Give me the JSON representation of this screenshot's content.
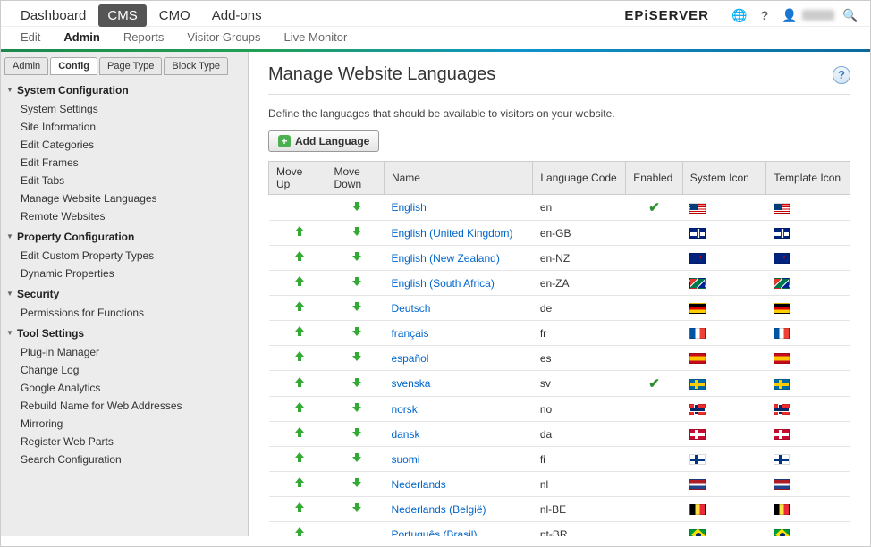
{
  "topnav": {
    "items": [
      "Dashboard",
      "CMS",
      "CMO",
      "Add-ons"
    ],
    "active_index": 1,
    "brand": "EPiSERVER"
  },
  "subnav": {
    "items": [
      "Edit",
      "Admin",
      "Reports",
      "Visitor Groups",
      "Live Monitor"
    ],
    "active_index": 1
  },
  "sideTabs": {
    "items": [
      "Admin",
      "Config",
      "Page Type",
      "Block Type"
    ],
    "active_index": 1
  },
  "tree": [
    {
      "label": "System Configuration",
      "items": [
        "System Settings",
        "Site Information",
        "Edit Categories",
        "Edit Frames",
        "Edit Tabs",
        "Manage Website Languages",
        "Remote Websites"
      ]
    },
    {
      "label": "Property Configuration",
      "items": [
        "Edit Custom Property Types",
        "Dynamic Properties"
      ]
    },
    {
      "label": "Security",
      "items": [
        "Permissions for Functions"
      ]
    },
    {
      "label": "Tool Settings",
      "items": [
        "Plug-in Manager",
        "Change Log",
        "Google Analytics",
        "Rebuild Name for Web Addresses",
        "Mirroring",
        "Register Web Parts",
        "Search Configuration"
      ]
    }
  ],
  "page": {
    "title": "Manage Website Languages",
    "description": "Define the languages that should be available to visitors on your website.",
    "add_button": "Add Language"
  },
  "table": {
    "headers": {
      "move_up": "Move Up",
      "move_down": "Move Down",
      "name": "Name",
      "code": "Language Code",
      "enabled": "Enabled",
      "sys_icon": "System Icon",
      "tpl_icon": "Template Icon"
    },
    "rows": [
      {
        "name": "English",
        "code": "en",
        "enabled": true,
        "flag": "us",
        "canUp": false,
        "canDown": true
      },
      {
        "name": "English (United Kingdom)",
        "code": "en-GB",
        "enabled": false,
        "flag": "gb",
        "canUp": true,
        "canDown": true
      },
      {
        "name": "English (New Zealand)",
        "code": "en-NZ",
        "enabled": false,
        "flag": "nz",
        "canUp": true,
        "canDown": true
      },
      {
        "name": "English (South Africa)",
        "code": "en-ZA",
        "enabled": false,
        "flag": "za",
        "canUp": true,
        "canDown": true
      },
      {
        "name": "Deutsch",
        "code": "de",
        "enabled": false,
        "flag": "de",
        "canUp": true,
        "canDown": true
      },
      {
        "name": "français",
        "code": "fr",
        "enabled": false,
        "flag": "fr",
        "canUp": true,
        "canDown": true
      },
      {
        "name": "español",
        "code": "es",
        "enabled": false,
        "flag": "es",
        "canUp": true,
        "canDown": true
      },
      {
        "name": "svenska",
        "code": "sv",
        "enabled": true,
        "flag": "se",
        "canUp": true,
        "canDown": true
      },
      {
        "name": "norsk",
        "code": "no",
        "enabled": false,
        "flag": "no",
        "canUp": true,
        "canDown": true
      },
      {
        "name": "dansk",
        "code": "da",
        "enabled": false,
        "flag": "dk",
        "canUp": true,
        "canDown": true
      },
      {
        "name": "suomi",
        "code": "fi",
        "enabled": false,
        "flag": "fi",
        "canUp": true,
        "canDown": true
      },
      {
        "name": "Nederlands",
        "code": "nl",
        "enabled": false,
        "flag": "nl",
        "canUp": true,
        "canDown": true
      },
      {
        "name": "Nederlands (België)",
        "code": "nl-BE",
        "enabled": false,
        "flag": "be",
        "canUp": true,
        "canDown": true
      },
      {
        "name": "Português (Brasil)",
        "code": "pt-BR",
        "enabled": false,
        "flag": "br",
        "canUp": true,
        "canDown": false
      }
    ]
  }
}
